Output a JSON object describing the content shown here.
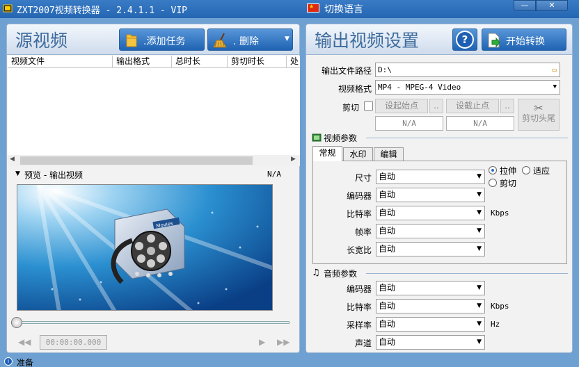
{
  "window": {
    "title": "ZXT2007视频转换器 - 2.4.1.1 - VIP",
    "language_button": "切换语言",
    "minimize_label": "—",
    "close_label": "✕"
  },
  "source_panel": {
    "title": "源视频",
    "add_task_label": ".添加任务",
    "delete_label": ".  删除",
    "columns": [
      "视频文件",
      "输出格式",
      "总时长",
      "剪切时长",
      "处"
    ],
    "preview_label": "预览 - 输出视频",
    "preview_value": "N/A",
    "movie_badge": "Movies",
    "time_display": "00:00:00.000"
  },
  "output_panel": {
    "title": "输出视频设置",
    "help_label": "?",
    "start_label": "开始转换",
    "output_path_label": "输出文件路径",
    "output_path_value": "D:\\",
    "format_label": "视频格式",
    "format_value": "MP4 - MPEG-4 Video",
    "cut_label": "剪切",
    "set_start_label": "设起始点",
    "set_end_label": "设截止点",
    "ellipsis": "..",
    "start_value": "N/A",
    "end_value": "N/A",
    "cut_head_tail_label": "剪切头尾"
  },
  "video_params": {
    "section_title": "视频参数",
    "tabs": [
      "常规",
      "水印",
      "编辑"
    ],
    "rows": [
      {
        "label": "尺寸",
        "value": "自动",
        "unit": ""
      },
      {
        "label": "编码器",
        "value": "自动",
        "unit": ""
      },
      {
        "label": "比特率",
        "value": "自动",
        "unit": "Kbps"
      },
      {
        "label": "帧率",
        "value": "自动",
        "unit": ""
      },
      {
        "label": "长宽比",
        "value": "自动",
        "unit": ""
      }
    ],
    "radio_stretch": "拉伸",
    "radio_fit": "适应",
    "radio_crop": "剪切"
  },
  "audio_params": {
    "section_title": "音频参数",
    "rows": [
      {
        "label": "编码器",
        "value": "自动",
        "unit": ""
      },
      {
        "label": "比特率",
        "value": "自动",
        "unit": "Kbps"
      },
      {
        "label": "采样率",
        "value": "自动",
        "unit": "Hz"
      },
      {
        "label": "声道",
        "value": "自动",
        "unit": ""
      }
    ]
  },
  "status": {
    "text": "准备"
  }
}
